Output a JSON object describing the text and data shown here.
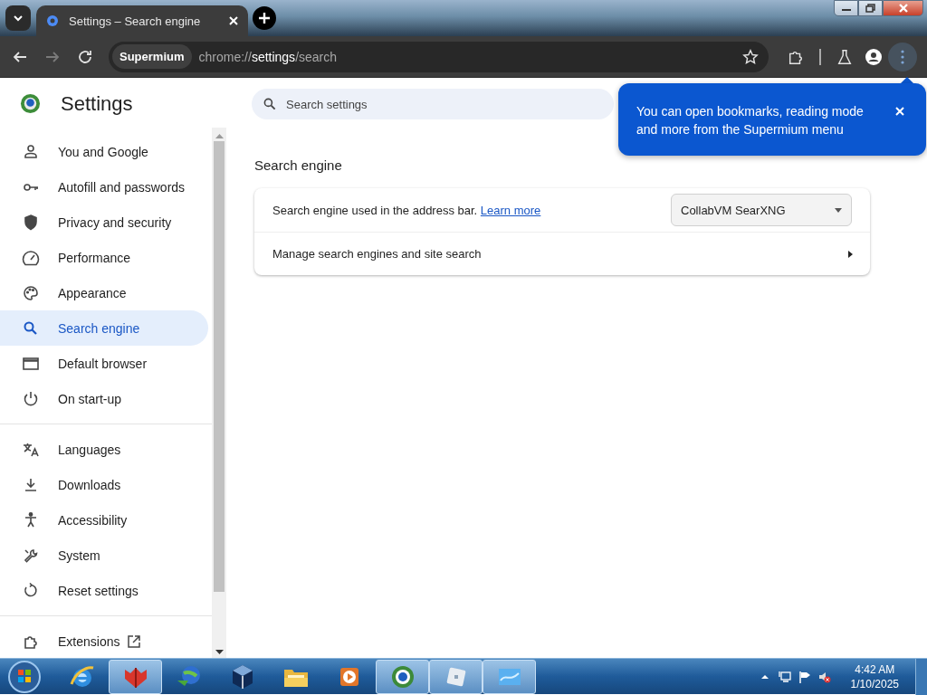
{
  "tab_strip": {
    "tab": {
      "title": "Settings – Search engine"
    }
  },
  "toolbar": {
    "nav": [
      {
        "kind": "back",
        "disabled": false
      },
      {
        "kind": "forward",
        "disabled": true
      },
      {
        "kind": "reload",
        "disabled": false
      }
    ],
    "omnibox": {
      "chip": "Supermium",
      "url": "chrome://**settings**/search"
    },
    "menu_highlighted": true
  },
  "sidebar": {
    "title": "Settings",
    "groups": [
      [
        {
          "label": "You and Google",
          "kind": "person",
          "selected": false
        },
        {
          "label": "Autofill and passwords",
          "kind": "key",
          "selected": false
        },
        {
          "label": "Privacy and security",
          "kind": "shield",
          "selected": false
        },
        {
          "label": "Performance",
          "kind": "gauge",
          "selected": false
        },
        {
          "label": "Appearance",
          "kind": "palette",
          "selected": false
        },
        {
          "label": "Search engine",
          "kind": "search",
          "selected": true
        },
        {
          "label": "Default browser",
          "kind": "window",
          "selected": false
        },
        {
          "label": "On start-up",
          "kind": "power",
          "selected": false
        }
      ],
      [
        {
          "label": "Languages",
          "kind": "translate",
          "selected": false
        },
        {
          "label": "Downloads",
          "kind": "download",
          "selected": false
        },
        {
          "label": "Accessibility",
          "kind": "accessibility",
          "selected": false
        },
        {
          "label": "System",
          "kind": "wrench",
          "selected": false
        },
        {
          "label": "Reset settings",
          "kind": "reset",
          "selected": false
        }
      ],
      [
        {
          "label": "Extensions",
          "kind": "extensions",
          "selected": false
        }
      ]
    ]
  },
  "search": {
    "placeholder": "Search settings"
  },
  "bubble": {
    "text": "You can open bookmarks, reading mode and more from the Supermium menu"
  },
  "section": {
    "title": "Search engine",
    "rows": [
      {
        "kind": "select",
        "label": "Search engine used in the address bar.",
        "link": "Learn more",
        "value": "CollabVM SearXNG"
      },
      {
        "kind": "subpage",
        "label": "Manage search engines and site search"
      }
    ]
  },
  "taskbar": {
    "apps": [
      {
        "kind": "ie",
        "running": false
      },
      {
        "kind": "redcube",
        "running": true
      },
      {
        "kind": "globe",
        "running": false
      },
      {
        "kind": "box",
        "running": false
      },
      {
        "kind": "folder",
        "running": false
      },
      {
        "kind": "player",
        "running": false
      },
      {
        "kind": "browser",
        "running": true
      },
      {
        "kind": "tile",
        "running": true
      },
      {
        "kind": "wave",
        "running": true
      }
    ],
    "clock": {
      "time": "4:42 AM",
      "date": "1/10/2025"
    }
  }
}
